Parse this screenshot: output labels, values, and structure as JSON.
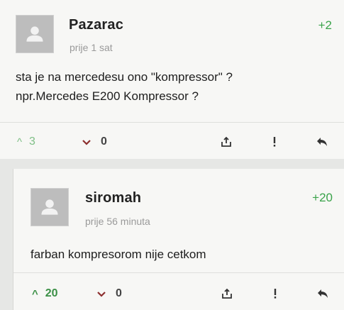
{
  "comments": [
    {
      "author": "Pazarac",
      "time": "prije 1 sat",
      "score": "+2",
      "text_lines": [
        "sta je na mercedesu ono \"kompressor\" ?",
        "npr.Mercedes E200 Kompressor ?"
      ],
      "upvotes": "3",
      "downvotes": "0"
    },
    {
      "author": "siromah",
      "time": "prije 56 minuta",
      "score": "+20",
      "text_lines": [
        "farban kompresorom nije cetkom"
      ],
      "upvotes": "20",
      "downvotes": "0"
    }
  ],
  "icons": {
    "upvote": "chevron-up-icon",
    "downvote": "chevron-down-icon",
    "share": "share-icon",
    "report": "exclamation-icon",
    "reply": "reply-arrow-icon"
  },
  "colors": {
    "score": "#3aa34a",
    "downvote": "#8c2e2e"
  }
}
